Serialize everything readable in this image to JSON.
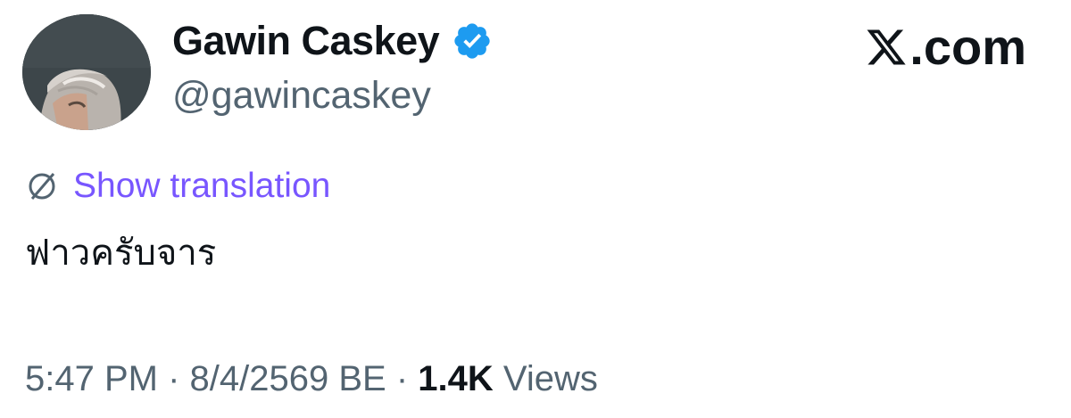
{
  "author": {
    "display_name": "Gawin Caskey",
    "handle": "@gawincaskey",
    "verified": true
  },
  "brand": {
    "label": ".com",
    "icon": "x-logo-icon"
  },
  "translation": {
    "label": "Show translation",
    "icon": "globe-translate-icon"
  },
  "tweet": {
    "text": "ฟาวครับจาร"
  },
  "meta": {
    "time": "5:47 PM",
    "separator": " · ",
    "date": "8/4/2569 BE",
    "views_count": "1.4K",
    "views_label": " Views"
  },
  "colors": {
    "verified": "#1d9bf0",
    "link": "#7856ff",
    "secondary_text": "#536471",
    "primary_text": "#0f1419"
  }
}
